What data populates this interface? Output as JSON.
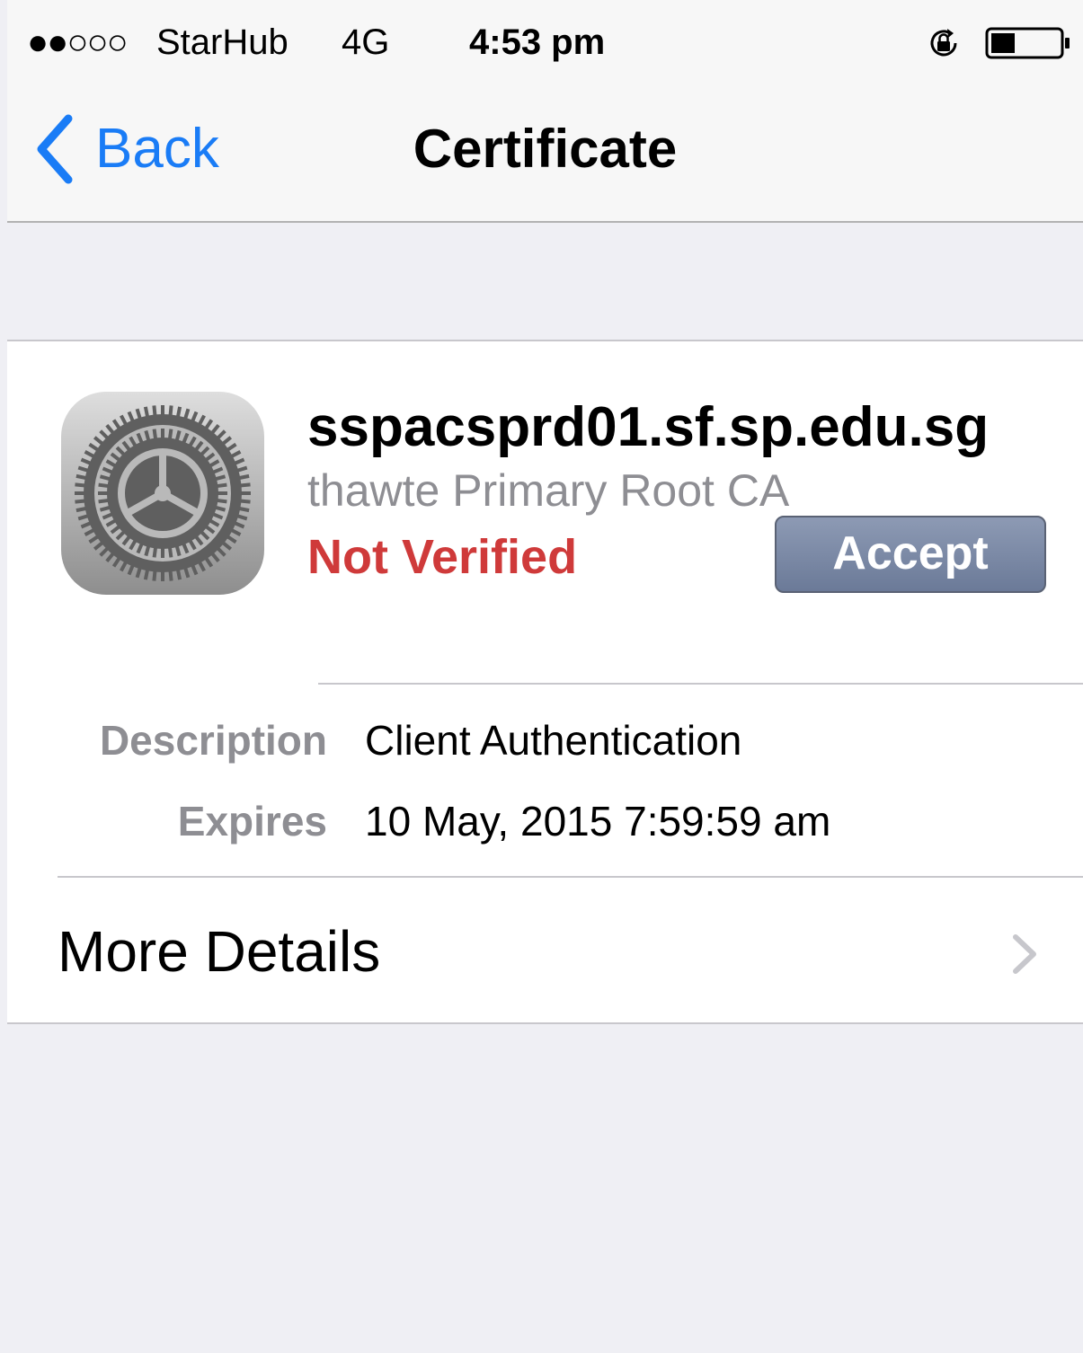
{
  "status_bar": {
    "signal": "●●○○○",
    "carrier": "StarHub",
    "network": "4G",
    "time": "4:53 pm",
    "lock_icon": "rotation-lock-icon",
    "battery_icon": "battery-icon",
    "battery_level": 0.35
  },
  "nav": {
    "back_label": "Back",
    "title": "Certificate"
  },
  "certificate": {
    "name": "sspacsprd01.sf.sp.edu.sg",
    "issuer": "thawte Primary Root CA",
    "status": "Not Verified",
    "accept_label": "Accept",
    "icon": "settings-gear-icon"
  },
  "details": [
    {
      "label": "Description",
      "value": "Client Authentication"
    },
    {
      "label": "Expires",
      "value": "10 May, 2015 7:59:59 am"
    }
  ],
  "more_details": {
    "label": "More Details"
  },
  "colors": {
    "accent": "#1a7cf6",
    "not_verified": "#cf3a3a",
    "accept_button": "#7b88a6",
    "background": "#efeff4"
  }
}
